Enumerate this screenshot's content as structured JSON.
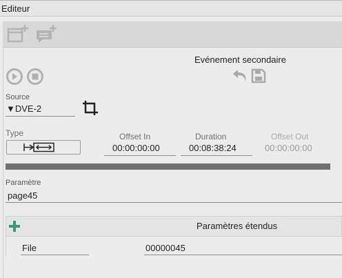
{
  "window": {
    "title": "Editeur"
  },
  "toolbar": {
    "add_icon": "new-window-plus-icon",
    "comment_icon": "comment-plus-icon"
  },
  "secondary_event": {
    "title": "Evénement secondaire",
    "undo_icon": "undo-icon",
    "save_icon": "save-icon"
  },
  "playback": {
    "play_icon": "play-circle-icon",
    "stop_icon": "stop-circle-icon"
  },
  "source": {
    "label": "Source",
    "value": "▼DVE-2",
    "crop_icon": "crop-icon"
  },
  "type": {
    "label": "Type",
    "icon": "transition-arrows-icon"
  },
  "offset_in": {
    "label": "Offset In",
    "value": "00:00:00:00"
  },
  "duration": {
    "label": "Duration",
    "value": "00:08:38:24"
  },
  "offset_out": {
    "label": "Offset Out",
    "value": "00:00:00:00"
  },
  "parameter": {
    "label": "Paramètre",
    "value": "page45"
  },
  "extended": {
    "add_icon": "plus-icon",
    "title": "Paramètres étendus"
  },
  "extended_rows": [
    {
      "name": "File",
      "value": "00000045"
    }
  ],
  "colors": {
    "accent": "#2e9c78",
    "progress": "#707070",
    "background": "#ececec"
  }
}
